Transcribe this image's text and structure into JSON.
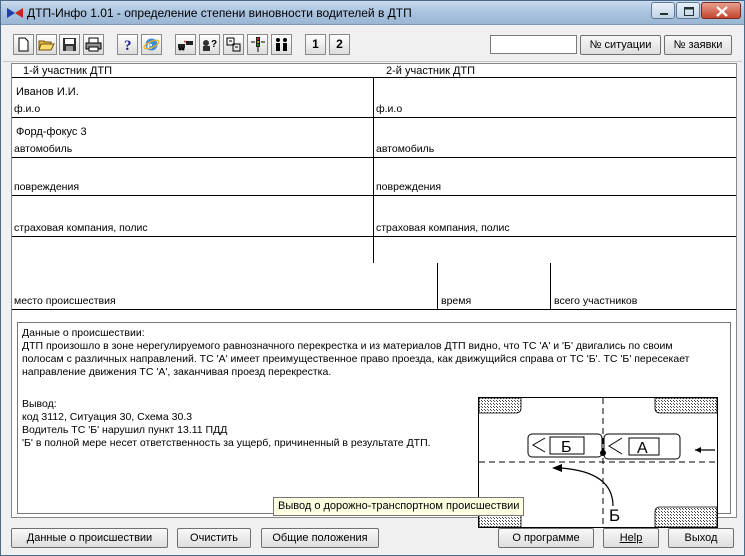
{
  "window": {
    "title": "ДТП-Инфо 1.01 - определение степени виновности водителей в ДТП"
  },
  "toolbar": {
    "icons": [
      "new-document-icon",
      "open-folder-icon",
      "save-icon",
      "print-icon",
      "help-question-icon",
      "internet-explorer-icon",
      "car-collision-icon",
      "driver-question-icon",
      "road-signs-icon",
      "traffic-light-icon",
      "people-icon"
    ],
    "participant_1_label": "1",
    "participant_2_label": "2",
    "search_value": "",
    "situation_button": "№ ситуации",
    "request_button": "№ заявки"
  },
  "form": {
    "header_1": "1-й участник ДТП",
    "header_2": "2-й участник ДТП",
    "p1_name": "Иванов И.И.",
    "p2_name": "",
    "label_fio": "ф.и.о",
    "p1_car": "Форд-фокус 3",
    "p2_car": "",
    "label_car": "автомобиль",
    "label_damage": "повреждения",
    "label_insurance": "страховая компания, полис",
    "label_place": "место происшествия",
    "label_time": "время",
    "label_total": "всего участников"
  },
  "info": {
    "heading": "Данные о происшествии:",
    "line1": "ДТП произошло в зоне нерегулируемого равнозначного перекрестка и из материалов ДТП видно, что ТС 'А' и 'Б' двигались по своим",
    "line2": "полосам с различных направлений. ТС 'А' имеет преимущественное право проезда, как движущийся справа от ТС 'Б'. ТС 'Б' пересекает",
    "line3": "направление движения ТС 'А', заканчивая проезд перекрестка.",
    "conclusion_heading": "Вывод:",
    "conclusion1": "код 3112, Ситуация 30, Схема 30.3",
    "conclusion2": "Водитель ТС 'Б' нарушил пункт 13.11 ПДД",
    "conclusion3": "'Б' в полной мере несет ответственность за ущерб, причиненный в результате ДТП."
  },
  "diagram": {
    "car_b_label": "Б",
    "car_a_label": "А",
    "trajectory_label": "Б"
  },
  "tooltip": "Вывод о дорожно-транспортном происшествии",
  "bottom": {
    "incident_data": "Данные о происшествии",
    "clear": "Очистить",
    "general": "Общие положения",
    "about": "О программе",
    "help": "Help",
    "exit": "Выход"
  }
}
